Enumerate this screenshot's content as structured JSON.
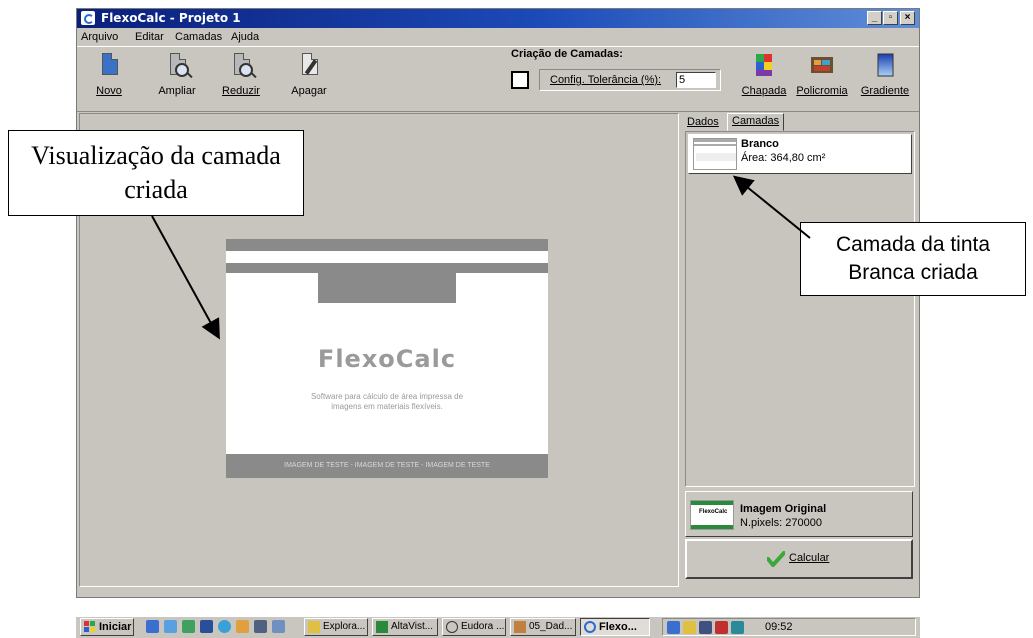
{
  "window": {
    "title": "FlexoCalc - Projeto 1"
  },
  "menu": [
    "Arquivo",
    "Editar",
    "Camadas",
    "Ajuda"
  ],
  "toolbar": {
    "buttons": [
      {
        "label": "Novo",
        "icon": "new-document-icon"
      },
      {
        "label": "Ampliar",
        "icon": "zoom-in-icon"
      },
      {
        "label": "Reduzir",
        "icon": "zoom-out-icon"
      },
      {
        "label": "Apagar",
        "icon": "erase-icon"
      }
    ],
    "layer_creation_label": "Criação de Camadas:",
    "tolerance_label": "Config. Tolerância (%):",
    "tolerance_value": "5",
    "color_buttons": [
      {
        "label": "Chapada",
        "icon": "solid-color-icon"
      },
      {
        "label": "Policromia",
        "icon": "polychrome-icon"
      },
      {
        "label": "Gradiente",
        "icon": "gradient-icon"
      }
    ]
  },
  "preview": {
    "logo": "FlexoCalc",
    "subtitle": "Software para cálculo de área impressa de imagens em materiais flexíveis.",
    "banner": "IMAGEM DE TESTE - IMAGEM DE TESTE - IMAGEM DE TESTE"
  },
  "tabs": [
    "Dados",
    "Camadas"
  ],
  "layers": [
    {
      "name": "Branco",
      "area": "Área: 364,80 cm²"
    }
  ],
  "original": {
    "name": "Imagem Original",
    "pixels": "N.pixels: 270000"
  },
  "calculate_label": "Calcular",
  "callouts": {
    "preview": "Visualização da camada criada",
    "layer": "Camada da tinta Branca criada"
  },
  "taskbar": {
    "start": "Iniciar",
    "tasks": [
      "Explora...",
      "AltaVist...",
      "Eudora ...",
      "05_Dad...",
      "Flexo..."
    ],
    "time": "09:52"
  },
  "colors": {
    "title_start": "#0a1f7a",
    "title_end": "#5f8fd8",
    "face": "#c9c6c0",
    "preview_bar": "#8a8a8a",
    "check": "#3aa83a"
  }
}
